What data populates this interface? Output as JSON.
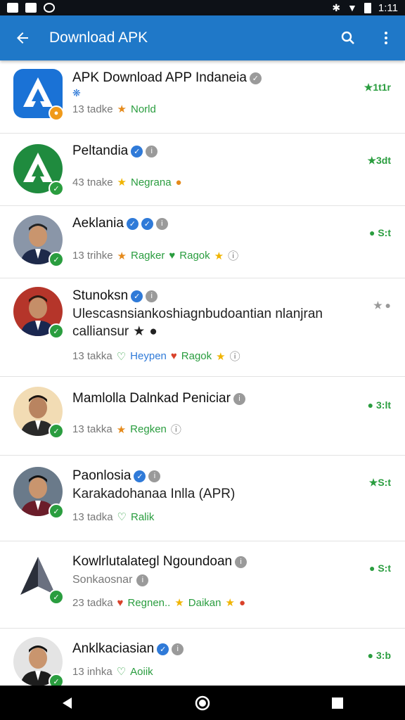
{
  "status_bar": {
    "time": "1:11"
  },
  "app_bar": {
    "title": "Download APK"
  },
  "items": [
    {
      "name": "APK Download APP Indaneia",
      "sub": "",
      "meta": "13 tadke",
      "tag1": "Norld",
      "tag2": "",
      "stat": "1t1r"
    },
    {
      "name": "Peltandia",
      "sub": "",
      "meta": "43 tnake",
      "tag1": "Negrana",
      "tag2": "",
      "stat": "3dt"
    },
    {
      "name": "Aeklania",
      "sub": "",
      "meta": "13 trihke",
      "tag1": "Ragker",
      "tag2": "Ragok",
      "stat": "S:t"
    },
    {
      "name": "Stunoksn",
      "sub": "Ulescasnsiankoshiagnbudoantian nlanjran",
      "sub2": "calliansur",
      "meta": "13 takka",
      "tag1": "Heypen",
      "tag2": "Ragok",
      "stat": ""
    },
    {
      "name": "Mamlolla Dalnkad Peniciar",
      "sub": "",
      "meta": "13 takka",
      "tag1": "Regken",
      "tag2": "",
      "stat": "3:lt"
    },
    {
      "name": "Paonlosia",
      "sub": "Karakadohanaa Inlla (APR)",
      "meta": "13 tadka",
      "tag1": "Ralik",
      "tag2": "",
      "stat": "S:t"
    },
    {
      "name": "Kowlrlutalategl Ngoundoan",
      "sub": "Sonkaosnar",
      "meta": "23 tadka",
      "tag1": "Regnen..",
      "tag2": "Daikan",
      "stat": "S:t"
    },
    {
      "name": "Anklkaciasian",
      "sub": "",
      "meta": "13 inhka",
      "tag1": "Aoiik",
      "tag2": "",
      "stat": "3:b"
    }
  ],
  "colors": {
    "app_bar": "#1f78c8",
    "green": "#2a9d3f"
  }
}
